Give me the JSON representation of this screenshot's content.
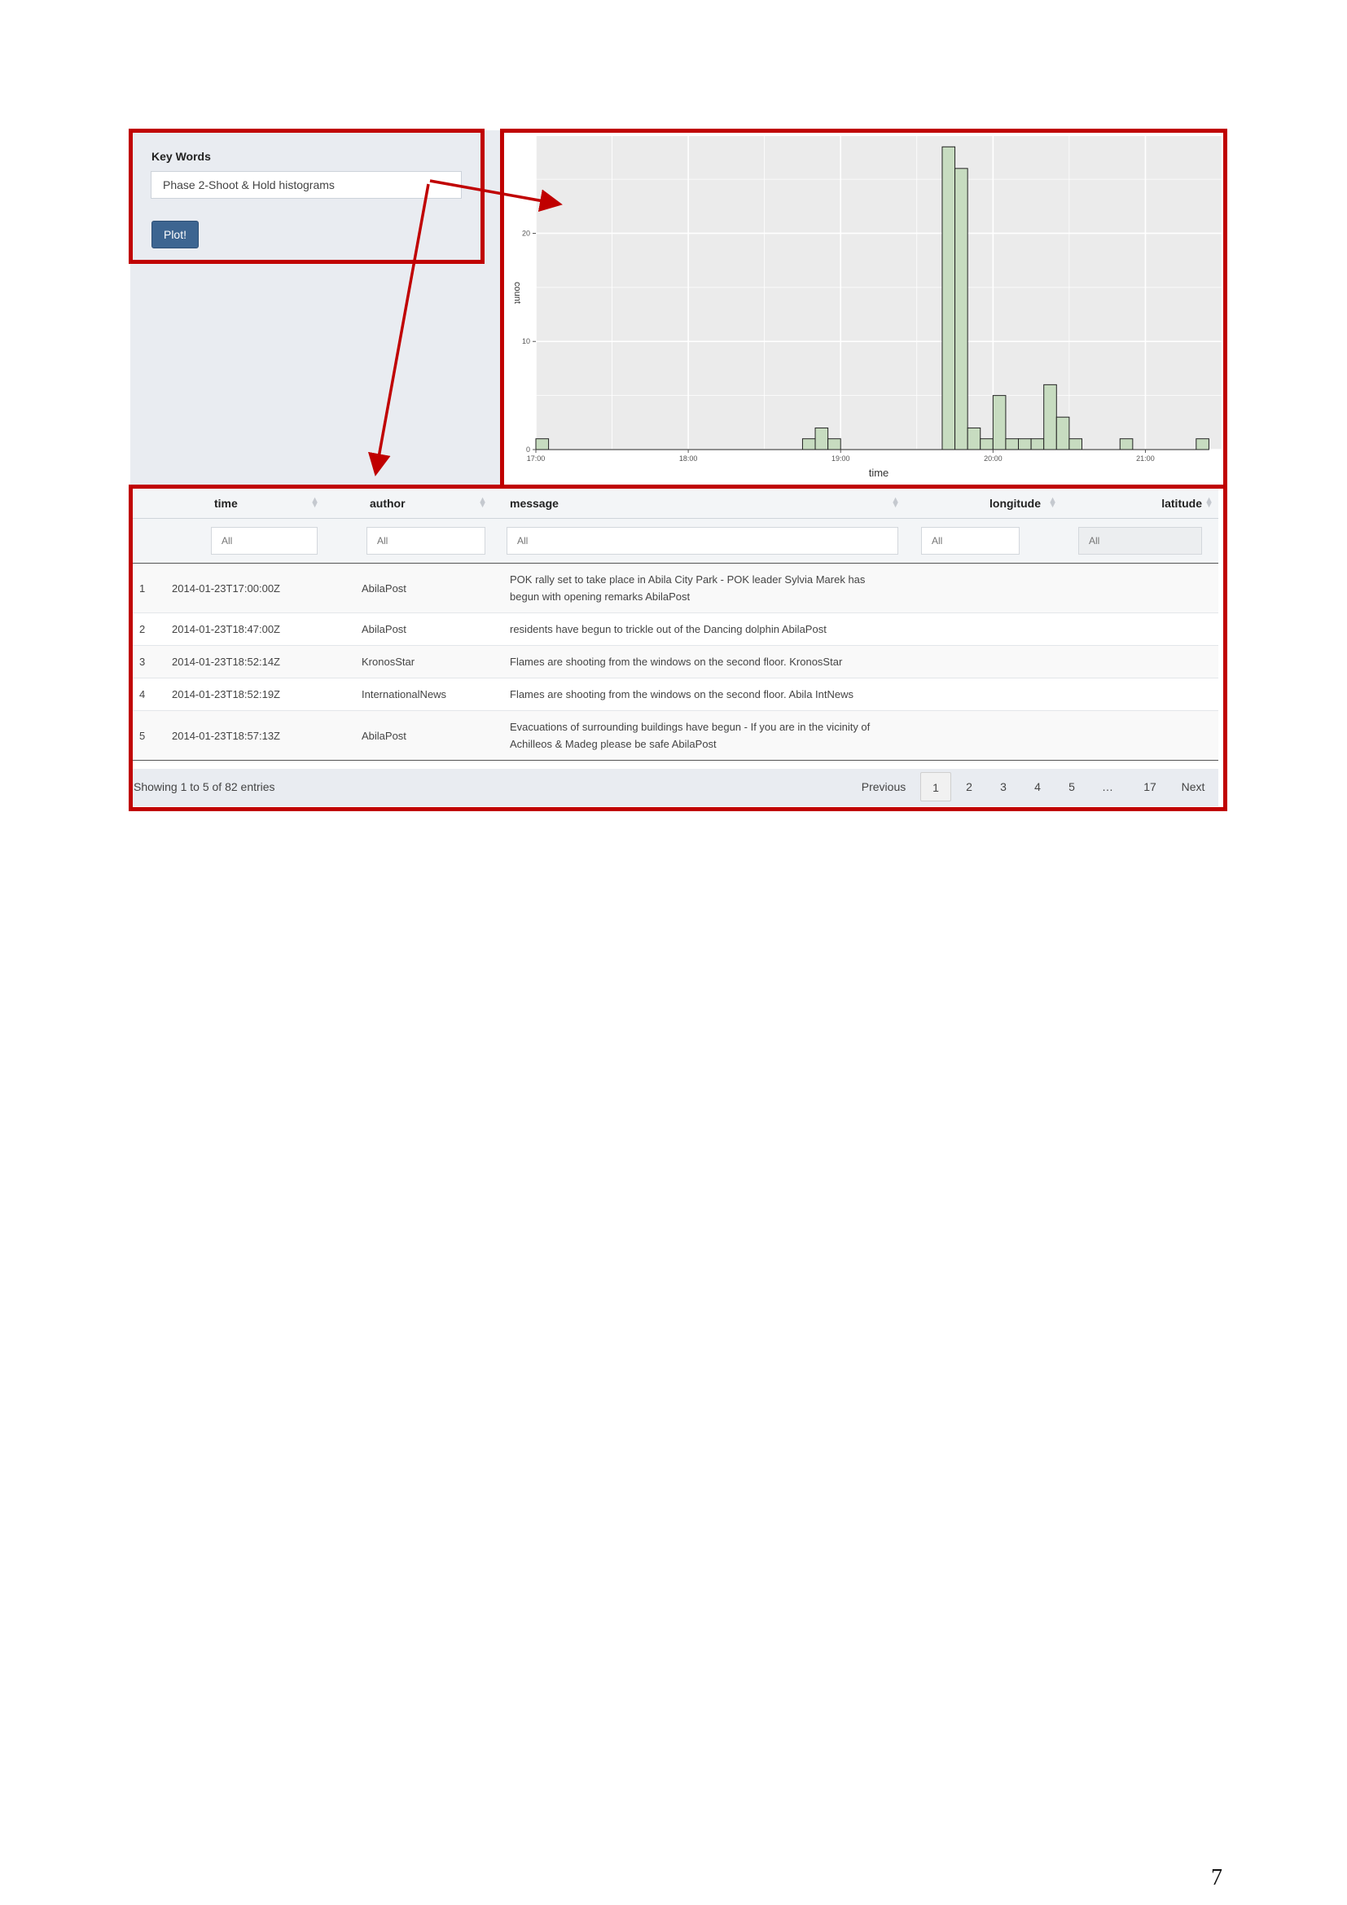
{
  "sidebar": {
    "keyword_label": "Key Words",
    "keyword_value": "Phase 2-Shoot & Hold histograms",
    "plot_button": "Plot!"
  },
  "chart_data": {
    "type": "bar",
    "xlabel": "time",
    "ylabel": "count",
    "x_ticks": [
      "17:00",
      "18:00",
      "19:00",
      "20:00",
      "21:00"
    ],
    "y_ticks": [
      "0",
      "10",
      "20"
    ],
    "xlim": [
      "17:00",
      "21:30"
    ],
    "ylim": [
      0,
      29
    ],
    "grid": true,
    "bar_fill": "#c7dcc0",
    "bar_stroke": "#222222",
    "panel_background": "#ebebeb",
    "bins": [
      {
        "start": "17:00",
        "end": "17:05",
        "count": 1
      },
      {
        "start": "18:45",
        "end": "18:50",
        "count": 1
      },
      {
        "start": "18:50",
        "end": "18:55",
        "count": 2
      },
      {
        "start": "18:55",
        "end": "19:00",
        "count": 1
      },
      {
        "start": "19:40",
        "end": "19:45",
        "count": 28
      },
      {
        "start": "19:45",
        "end": "19:50",
        "count": 26
      },
      {
        "start": "19:50",
        "end": "19:55",
        "count": 2
      },
      {
        "start": "19:55",
        "end": "20:00",
        "count": 1
      },
      {
        "start": "20:00",
        "end": "20:05",
        "count": 5
      },
      {
        "start": "20:05",
        "end": "20:10",
        "count": 1
      },
      {
        "start": "20:10",
        "end": "20:15",
        "count": 1
      },
      {
        "start": "20:15",
        "end": "20:20",
        "count": 1
      },
      {
        "start": "20:20",
        "end": "20:25",
        "count": 6
      },
      {
        "start": "20:25",
        "end": "20:30",
        "count": 3
      },
      {
        "start": "20:30",
        "end": "20:35",
        "count": 1
      },
      {
        "start": "20:50",
        "end": "20:55",
        "count": 1
      },
      {
        "start": "21:20",
        "end": "21:25",
        "count": 1
      }
    ]
  },
  "table": {
    "columns": [
      "",
      "time",
      "author",
      "message",
      "longitude",
      "latitude"
    ],
    "filter_placeholder": "All",
    "rows": [
      {
        "index": "1",
        "time": "2014-01-23T17:00:00Z",
        "author": "AbilaPost",
        "message": "POK rally set to take place in Abila City Park - POK leader Sylvia Marek has begun with opening remarks AbilaPost",
        "longitude": "",
        "latitude": ""
      },
      {
        "index": "2",
        "time": "2014-01-23T18:47:00Z",
        "author": "AbilaPost",
        "message": "residents have begun to trickle out of the Dancing dolphin AbilaPost",
        "longitude": "",
        "latitude": ""
      },
      {
        "index": "3",
        "time": "2014-01-23T18:52:14Z",
        "author": "KronosStar",
        "message": "Flames are shooting from the windows on the second floor. KronosStar",
        "longitude": "",
        "latitude": ""
      },
      {
        "index": "4",
        "time": "2014-01-23T18:52:19Z",
        "author": "InternationalNews",
        "message": "Flames are shooting from the windows on the second floor. Abila IntNews",
        "longitude": "",
        "latitude": ""
      },
      {
        "index": "5",
        "time": "2014-01-23T18:57:13Z",
        "author": "AbilaPost",
        "message": "Evacuations of surrounding buildings have begun - If you are in the vicinity of Achilleos & Madeg please be safe AbilaPost",
        "longitude": "",
        "latitude": ""
      }
    ],
    "info": "Showing 1 to 5 of 82 entries",
    "pagination": {
      "previous": "Previous",
      "pages": [
        "1",
        "2",
        "3",
        "4",
        "5",
        "…",
        "17"
      ],
      "next": "Next",
      "current": "1"
    }
  },
  "colors": {
    "highlight_box": "#c00000",
    "button": "#3d6591"
  },
  "page_number": "7"
}
